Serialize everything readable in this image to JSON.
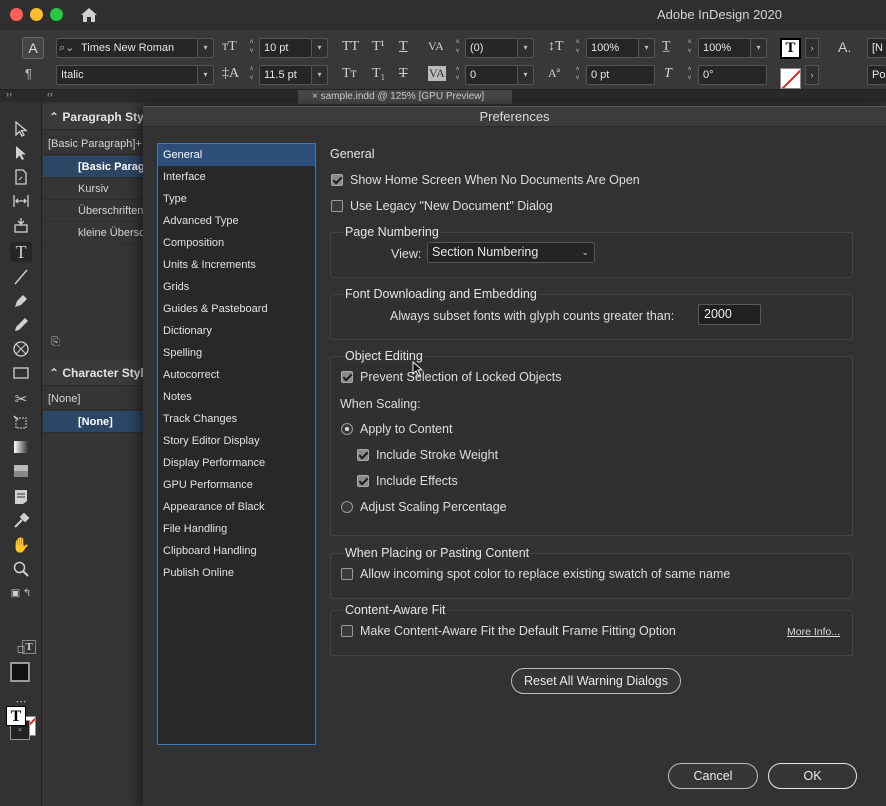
{
  "window": {
    "app_title": "Adobe InDesign 2020"
  },
  "control_bar": {
    "mode_glyph": "A",
    "paragraph_glyph": "¶",
    "font_family": "Times New Roman",
    "font_style": "Italic",
    "font_size": "10 pt",
    "leading": "11.5 pt",
    "kerning": "(0)",
    "tracking": "0",
    "vertical_scale": "100%",
    "horizontal_scale": "100%",
    "baseline_shift": "0 pt",
    "skew": "0°",
    "char_style_fragment_1": "[N",
    "char_style_fragment_2": "Pol",
    "caps_labels": [
      "TT",
      "T¹",
      "T",
      "Tт",
      "T₁",
      "T"
    ],
    "swatch_letter": "T"
  },
  "doc_tab_fragment": "× sample.indd @ 125% [GPU Preview]",
  "paragraph_styles": {
    "title": "Paragraph Styles",
    "current": "[Basic Paragraph]+",
    "items": [
      {
        "label": "[Basic Paragraph]",
        "selected": true
      },
      {
        "label": "Kursiv",
        "selected": false
      },
      {
        "label": "Überschriften",
        "selected": false
      },
      {
        "label": "kleine Überschrift",
        "selected": false
      }
    ]
  },
  "character_styles": {
    "title": "Character Styles",
    "current": "[None]",
    "items": [
      {
        "label": "[None]",
        "selected": true
      }
    ]
  },
  "toolbar": {
    "fill_letter": "T",
    "small_t": "T"
  },
  "preferences": {
    "title": "Preferences",
    "categories": [
      "General",
      "Interface",
      "Type",
      "Advanced Type",
      "Composition",
      "Units & Increments",
      "Grids",
      "Guides & Pasteboard",
      "Dictionary",
      "Spelling",
      "Autocorrect",
      "Notes",
      "Track Changes",
      "Story Editor Display",
      "Display Performance",
      "GPU Performance",
      "Appearance of Black",
      "File Handling",
      "Clipboard Handling",
      "Publish Online"
    ],
    "selected_category": "General",
    "general": {
      "heading": "General",
      "show_home_screen": {
        "label": "Show Home Screen When No Documents Are Open",
        "checked": true
      },
      "legacy_new_doc": {
        "label": "Use Legacy \"New Document\" Dialog",
        "checked": false
      },
      "page_numbering": {
        "title": "Page Numbering",
        "view_label": "View:",
        "view_value": "Section Numbering"
      },
      "font_downloading": {
        "title": "Font Downloading and Embedding",
        "subset_label": "Always subset fonts with glyph counts greater than:",
        "subset_value": "2000"
      },
      "object_editing": {
        "title": "Object Editing",
        "prevent_locked": {
          "label": "Prevent Selection of Locked Objects",
          "checked": true
        },
        "when_scaling": "When Scaling:",
        "apply_to_content": {
          "label": "Apply to Content",
          "selected": true
        },
        "include_stroke": {
          "label": "Include Stroke Weight",
          "checked": true
        },
        "include_effects": {
          "label": "Include Effects",
          "checked": true
        },
        "adjust_scaling": {
          "label": "Adjust Scaling Percentage",
          "selected": false
        }
      },
      "placing": {
        "title": "When Placing or Pasting Content",
        "spot_color": {
          "label": "Allow incoming spot color to replace existing swatch of same name",
          "checked": false
        }
      },
      "content_aware": {
        "title": "Content-Aware Fit",
        "default_option": {
          "label": "Make Content-Aware Fit the Default Frame Fitting Option",
          "checked": false
        },
        "more_info": "More Info..."
      },
      "reset_warnings": "Reset All Warning Dialogs"
    },
    "cancel": "Cancel",
    "ok": "OK"
  }
}
